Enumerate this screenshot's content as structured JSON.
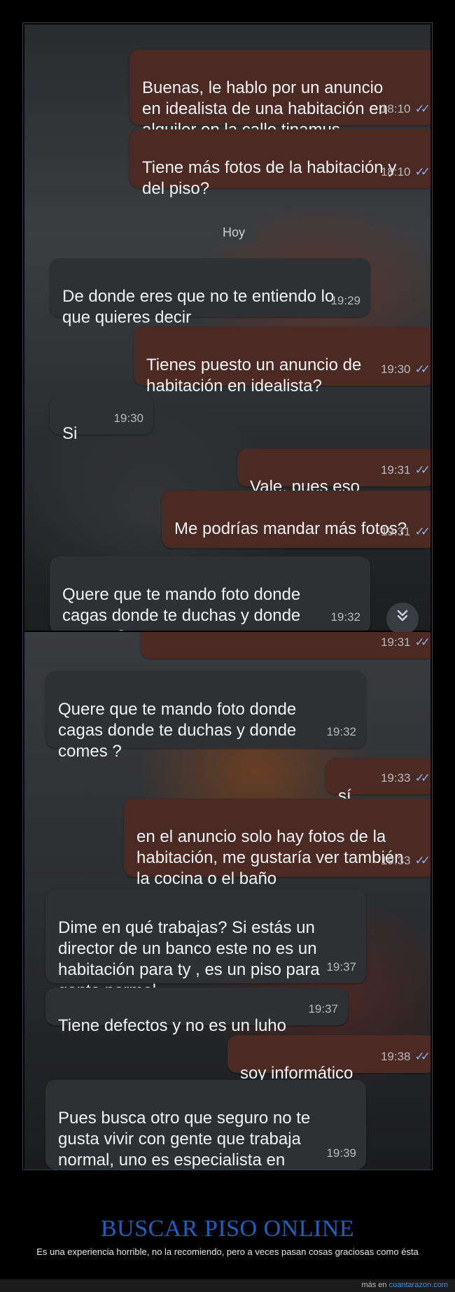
{
  "screenshot_1": {
    "day_separator": "Hoy",
    "messages": [
      {
        "text": "Buenas, le hablo por un anuncio\nen idealista de una habitación en\nalquiler en la calle tinamus",
        "time": "18:10",
        "ticks": "✓✓"
      },
      {
        "text": "Tiene más fotos de la habitación y\ndel piso?",
        "time": "18:10",
        "ticks": "✓✓"
      },
      {
        "text": "De donde eres que no te entiendo lo\nque quieres decir",
        "time": "19:29"
      },
      {
        "text": "Tienes puesto un anuncio de\nhabitación en idealista?",
        "time": "19:30",
        "ticks": "✓✓"
      },
      {
        "text": "Si",
        "time": "19:30"
      },
      {
        "text": "Vale, pues eso",
        "time": "19:31",
        "ticks": "✓✓"
      },
      {
        "text": "Me podrías mandar más fotos?",
        "time": "19:31",
        "ticks": "✓✓"
      },
      {
        "text": "Quere que te mando foto donde\ncagas donde te duchas y donde\ncomes ?",
        "time": "19:32"
      }
    ],
    "scroll_down_icon": "chevron-double-down-icon"
  },
  "screenshot_2": {
    "messages": [
      {
        "text": "",
        "time": "19:31",
        "ticks": "✓✓"
      },
      {
        "text": "Quere que te mando foto donde\ncagas donde te duchas y donde\ncomes ?",
        "time": "19:32"
      },
      {
        "text": "sí",
        "time": "19:33",
        "ticks": "✓✓"
      },
      {
        "text": "en el anuncio solo hay fotos de la\nhabitación, me gustaría ver también\nla cocina o el baño",
        "time": "19:33",
        "ticks": "✓✓"
      },
      {
        "text": "Dime en qué trabajas? Si estás un\ndirector de un banco este no es un\nhabitación para ty , es un piso para\ngente normal,",
        "time": "19:37"
      },
      {
        "text": "Tiene defectos y no es un luho",
        "time": "19:37"
      },
      {
        "text": "soy informático",
        "time": "19:38",
        "ticks": "✓✓"
      },
      {
        "text": "Pues busca otro que seguro no te\ngusta vivir con gente que trabaja\nnormal, uno es especialista en\ncristales y un albañil,",
        "time": "19:39"
      }
    ]
  },
  "post": {
    "title": "BUSCAR PISO ONLINE",
    "description": "Es una experiencia horrible, no la recomiendo, pero a veces pasan cosas graciosas como ésta",
    "footer_prefix": "más en",
    "footer_link": "cuantarazon.com"
  },
  "colors": {
    "outgoing_bubble": "#4a2a22",
    "incoming_bubble": "#2e3033",
    "read_ticks": "#8fb0e8",
    "title": "#1f5fbf",
    "footer_link": "#3d8fe0"
  }
}
